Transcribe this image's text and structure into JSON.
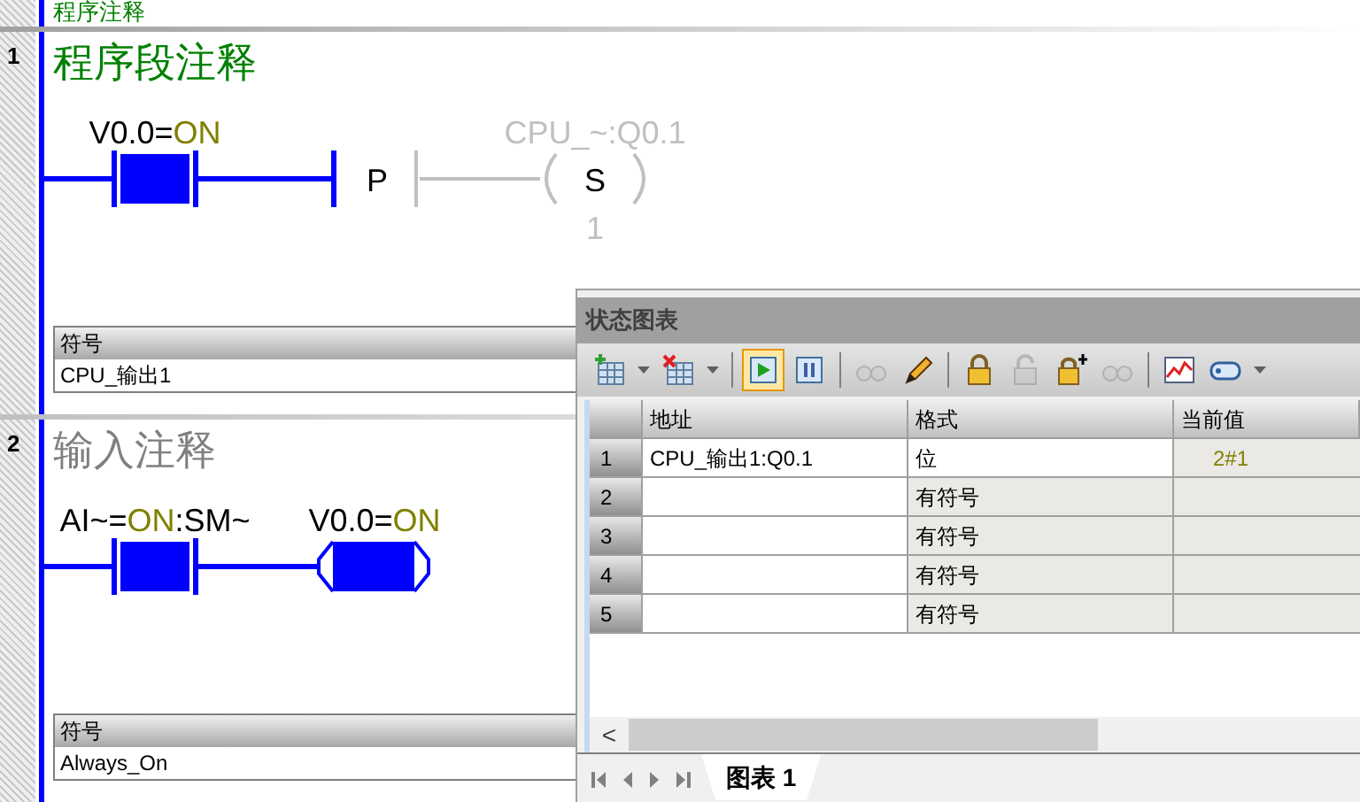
{
  "top_comment": "程序注释",
  "networks": [
    {
      "number": "1",
      "comment": "程序段注释",
      "comment_edited": true,
      "elements": [
        {
          "kind": "contact",
          "powered": true,
          "label": [
            {
              "text": "V0.0=",
              "kind": "plain"
            },
            {
              "text": "ON",
              "kind": "value"
            }
          ]
        },
        {
          "kind": "p_transition",
          "powered": true,
          "text": "P"
        },
        {
          "kind": "set_coil",
          "powered": false,
          "text": "S",
          "below": "1",
          "label": [
            {
              "text": "CPU_~:Q0.1",
              "kind": "plain"
            }
          ]
        }
      ],
      "symbol_header": "符号",
      "symbol": "CPU_输出1"
    },
    {
      "number": "2",
      "comment": "输入注释",
      "comment_edited": false,
      "elements": [
        {
          "kind": "contact",
          "powered": true,
          "label": [
            {
              "text": "AI~=",
              "kind": "plain"
            },
            {
              "text": "ON",
              "kind": "value"
            },
            {
              "text": ":SM~",
              "kind": "plain"
            }
          ]
        },
        {
          "kind": "coil",
          "powered": true,
          "label": [
            {
              "text": "V0.0=",
              "kind": "plain"
            },
            {
              "text": "ON",
              "kind": "value"
            }
          ]
        }
      ],
      "symbol_header": "符号",
      "symbol": "Always_On"
    }
  ],
  "status_chart": {
    "title": "状态图表",
    "toolbar": [
      {
        "kind": "add_table",
        "disabled": false
      },
      {
        "kind": "caret"
      },
      {
        "kind": "delete_table",
        "disabled": false
      },
      {
        "kind": "caret"
      },
      {
        "kind": "separator"
      },
      {
        "kind": "run",
        "disabled": false,
        "selected": true
      },
      {
        "kind": "pause",
        "disabled": false,
        "selected": false
      },
      {
        "kind": "separator"
      },
      {
        "kind": "glasses",
        "disabled": true
      },
      {
        "kind": "pencil",
        "disabled": false
      },
      {
        "kind": "separator"
      },
      {
        "kind": "lock",
        "disabled": false
      },
      {
        "kind": "unlock",
        "disabled": true
      },
      {
        "kind": "lock_plus",
        "disabled": false
      },
      {
        "kind": "glasses",
        "disabled": true
      },
      {
        "kind": "separator"
      },
      {
        "kind": "chart",
        "disabled": false
      },
      {
        "kind": "tag",
        "disabled": false
      },
      {
        "kind": "caret"
      }
    ],
    "columns": [
      "地址",
      "格式",
      "当前值"
    ],
    "rows": [
      {
        "number": "1",
        "address": "CPU_输出1:Q0.1",
        "format": "位",
        "value": "2#1",
        "format_editable": true
      },
      {
        "number": "2",
        "format": "有符号",
        "format_editable": false
      },
      {
        "number": "3",
        "format": "有符号",
        "format_editable": false
      },
      {
        "number": "4",
        "format": "有符号",
        "format_editable": false
      },
      {
        "number": "5",
        "format": "有符号",
        "format_editable": false
      }
    ],
    "scroll_left": "<",
    "tabs": [
      {
        "label": "图表 1",
        "selected": true
      }
    ]
  }
}
